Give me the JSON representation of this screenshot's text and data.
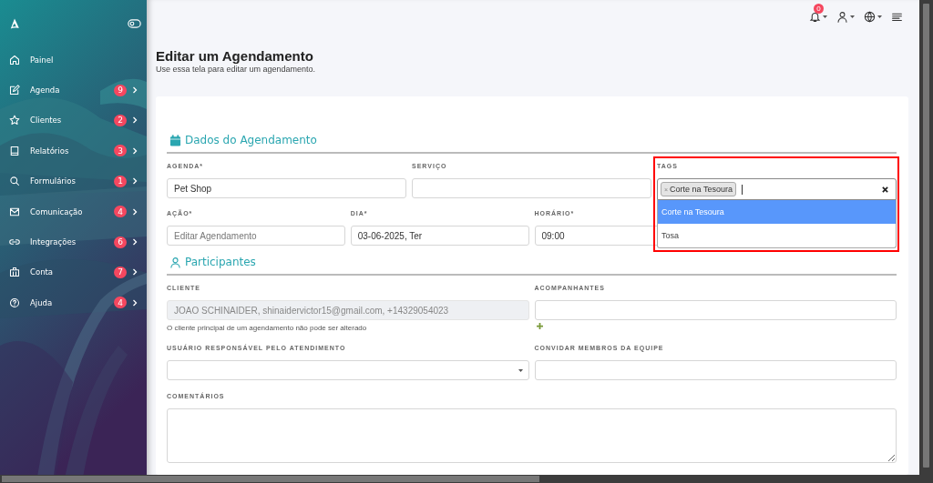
{
  "sidebar": {
    "items": [
      {
        "label": "Painel"
      },
      {
        "label": "Agenda",
        "badge": "9"
      },
      {
        "label": "Clientes",
        "badge": "2"
      },
      {
        "label": "Relatórios",
        "badge": "3"
      },
      {
        "label": "Formulários",
        "badge": "1"
      },
      {
        "label": "Comunicação",
        "badge": "4"
      },
      {
        "label": "Integrações",
        "badge": "6"
      },
      {
        "label": "Conta",
        "badge": "7"
      },
      {
        "label": "Ajuda",
        "badge": "4"
      }
    ]
  },
  "topbar": {
    "notifications_badge": "0"
  },
  "page": {
    "title": "Editar um Agendamento",
    "subtitle": "Use essa tela para editar um agendamento."
  },
  "sections": [
    {
      "kind": "dados",
      "title": "Dados do Agendamento",
      "agenda": {
        "label": "AGENDA*",
        "value": "Pet Shop"
      },
      "servico": {
        "label": "SERVIÇO"
      },
      "tags": {
        "label": "TAGS",
        "chips": [
          {
            "remove": "×",
            "label": "Corte na Tesoura"
          }
        ],
        "options": [
          {
            "label": "Corte na Tesoura",
            "selected": true
          },
          {
            "label": "Tosa",
            "selected": false
          }
        ]
      },
      "acao": {
        "label": "AÇÃO*",
        "placeholder": "Editar Agendamento"
      },
      "dia": {
        "label": "DIA*",
        "value": "03-06-2025, Ter"
      },
      "horario": {
        "label": "HORÁRIO*",
        "value": "09:00"
      }
    },
    {
      "kind": "participantes",
      "title": "Participantes",
      "cliente": {
        "label": "CLIENTE",
        "value": "JOAO SCHINAIDER, shinaidervictor15@gmail.com, +14329054023",
        "disabled": true,
        "help": "O cliente principal de um agendamento não pode ser alterado"
      },
      "acompanhantes": {
        "label": "ACOMPANHANTES"
      },
      "responsavel": {
        "label": "USUÁRIO RESPONSÁVEL PELO ATENDIMENTO"
      },
      "convidar": {
        "label": "CONVIDAR MEMBROS DA EQUIPE"
      },
      "comentarios": {
        "label": "COMENTÁRIOS"
      }
    }
  ]
}
